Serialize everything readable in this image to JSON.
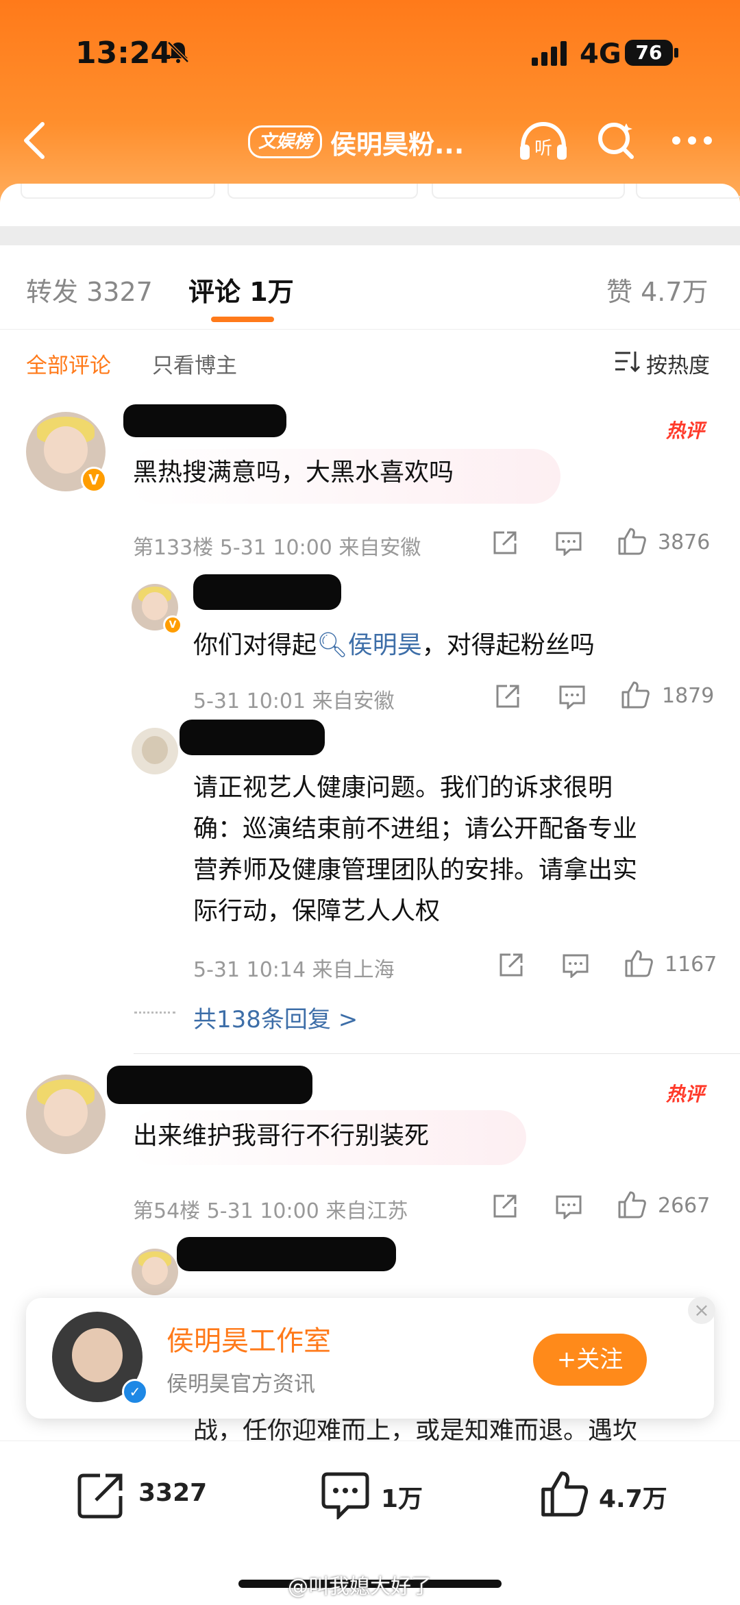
{
  "status_bar": {
    "time": "13:24",
    "network": "4G",
    "battery": "76"
  },
  "header": {
    "tag": "文娱榜",
    "title": "侯明昊粉..."
  },
  "tabs": {
    "repost_label": "转发",
    "repost_count": "3327",
    "comment_label": "评论",
    "comment_count": "1万",
    "like_label": "赞",
    "like_count": "4.7万"
  },
  "filters": {
    "all": "全部评论",
    "owner_only": "只看博主",
    "sort": "按热度"
  },
  "comments": [
    {
      "hot": "热评",
      "text": "黑热搜满意吗，大黑水喜欢吗",
      "meta": "第133楼  5-31 10:00  来自安徽",
      "likes": "3876",
      "replies": [
        {
          "text_before": "你们对得起",
          "mention": "侯明昊",
          "text_after": "，对得起粉丝吗",
          "meta": "5-31 10:01  来自安徽",
          "likes": "1879"
        },
        {
          "text_lines": [
            "请正视艺人健康问题。我们的诉求很明",
            "确：巡演结束前不进组；请公开配备专业",
            "营养师及健康管理团队的安排。请拿出实",
            "际行动，保障艺人人权"
          ],
          "meta": "5-31 10:14  来自上海",
          "likes": "1167"
        }
      ],
      "more_replies": "共138条回复 >"
    },
    {
      "hot": "热评",
      "text": "出来维护我哥行不行别装死",
      "meta": "第54楼  5-31 10:00  来自江苏",
      "likes": "2667"
    }
  ],
  "partial_reply_tail": "战，任你迎难而上，或是知难而退。遇坎",
  "popup": {
    "name": "侯明昊工作室",
    "desc": "侯明昊官方资讯",
    "follow": "+关注"
  },
  "bottom_bar": {
    "repost": "3327",
    "comment": "1万",
    "like": "4.7万"
  },
  "watermark": "@叫我媳大好了",
  "colors": {
    "accent": "#ff7a1a",
    "link": "#3d6ea8",
    "hot": "#ff3a2a"
  }
}
